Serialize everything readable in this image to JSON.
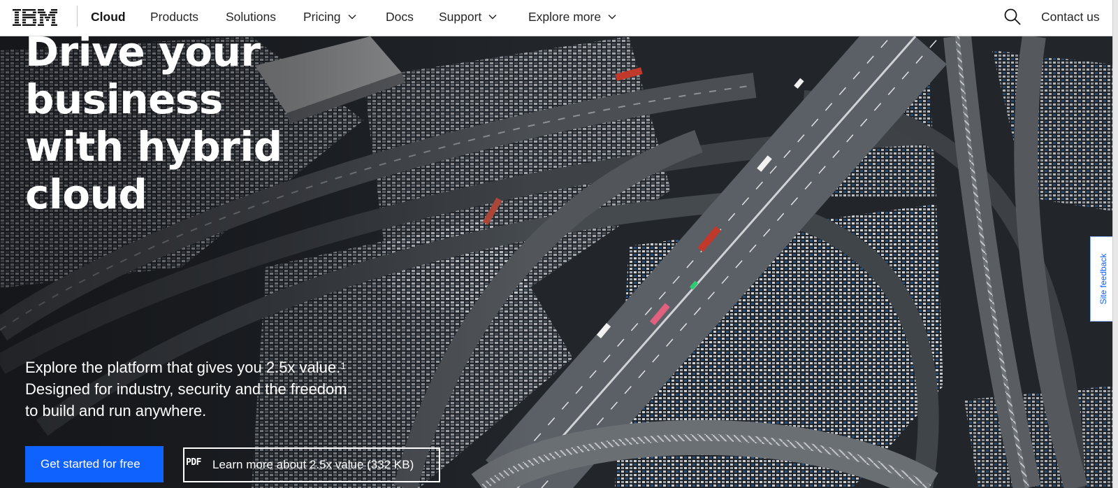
{
  "nav": {
    "logo": "IBM",
    "brand": "Cloud",
    "items": [
      {
        "label": "Products"
      },
      {
        "label": "Solutions"
      },
      {
        "label": "Pricing",
        "icon": "chevron-down-icon"
      },
      {
        "label": "Docs"
      },
      {
        "label": "Support",
        "icon": "chevron-down-icon"
      },
      {
        "label": "Explore more",
        "icon": "chevron-down-icon"
      }
    ],
    "search_icon": "search-icon",
    "contact": "Contact us"
  },
  "hero": {
    "title_lines": [
      "Drive your",
      "business",
      "with hybrid",
      "cloud"
    ],
    "description_part1": "Explore the platform that gives you 2.5x value.",
    "description_sup": "1",
    "description_part2": " Designed for industry, security and the freedom to build and run anywhere.",
    "primary_button": "Get started for free",
    "secondary_icon": "PDF",
    "secondary_button": "Learn more about 2.5x value (332 KB)"
  },
  "feedback": {
    "label": "Site feedback"
  },
  "colors": {
    "accent": "#0f62fe",
    "nav_bg": "#ffffff",
    "hero_text": "#ffffff"
  }
}
